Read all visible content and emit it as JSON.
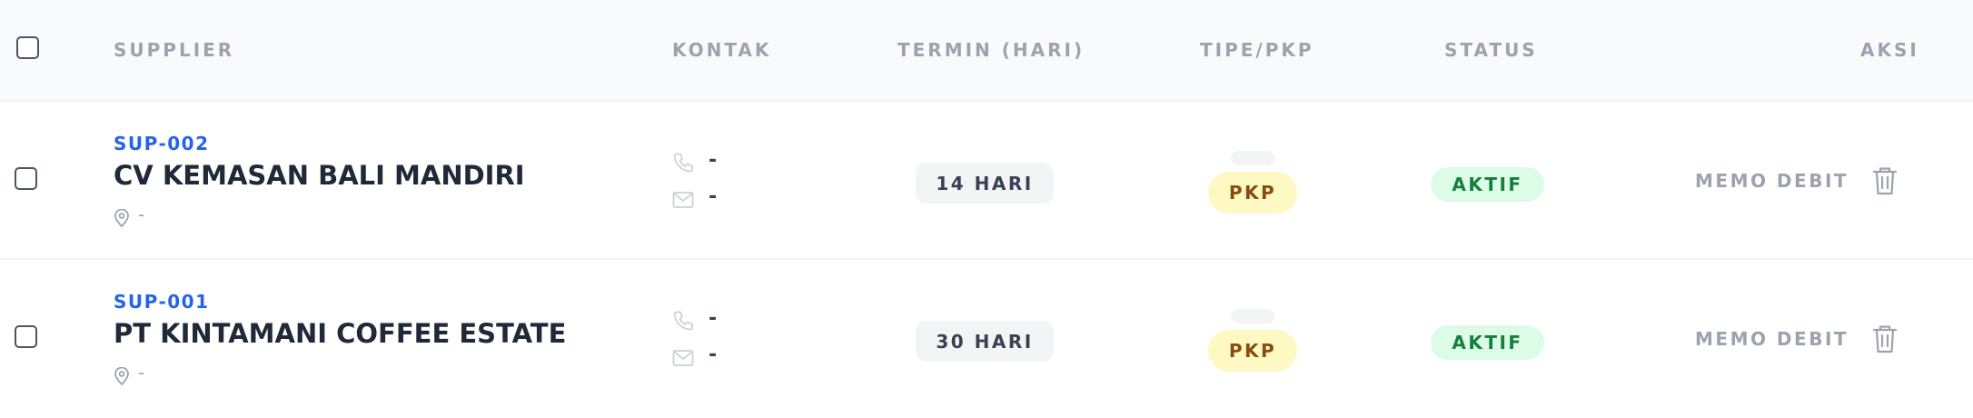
{
  "header": {
    "supplier": "SUPPLIER",
    "kontak": "KONTAK",
    "termin": "TERMIN (HARI)",
    "tipe": "TIPE/PKP",
    "status": "STATUS",
    "aksi": "AKSI"
  },
  "rows": [
    {
      "code": "SUP-002",
      "name": "CV KEMASAN BALI MANDIRI",
      "location": "-",
      "phone": "-",
      "email": "-",
      "termin": "14 HARI",
      "tipe": "PKP",
      "status": "AKTIF",
      "action": "MEMO DEBIT"
    },
    {
      "code": "SUP-001",
      "name": "PT KINTAMANI COFFEE ESTATE",
      "location": "-",
      "phone": "-",
      "email": "-",
      "termin": "30 HARI",
      "tipe": "PKP",
      "status": "AKTIF",
      "action": "MEMO DEBIT"
    }
  ],
  "icons": {
    "location": "map-pin-icon",
    "phone": "phone-icon",
    "email": "mail-icon",
    "delete": "trash-icon"
  },
  "colors": {
    "code": "#2563eb",
    "pkp_bg": "#fef9c3",
    "pkp_text": "#854d0e",
    "status_bg": "#dcfce7",
    "status_text": "#15803d"
  }
}
